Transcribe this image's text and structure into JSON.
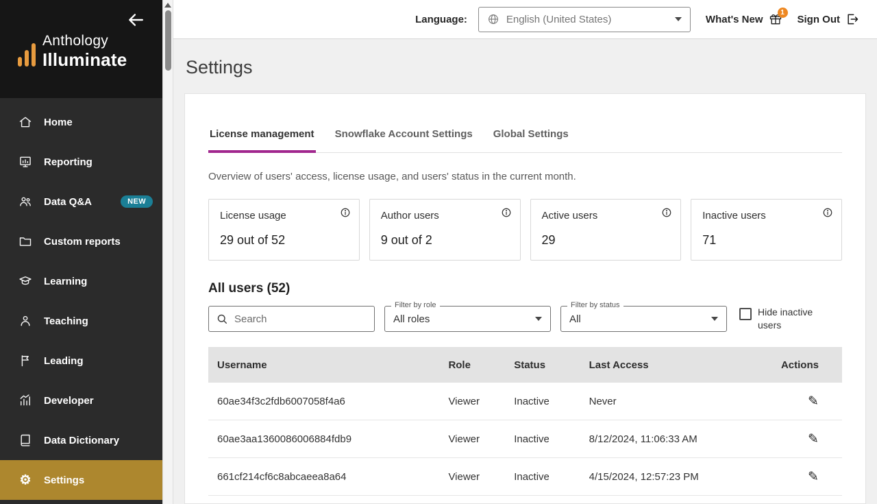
{
  "colors": {
    "gold": "#ad872e",
    "purple": "#a1278e",
    "teal": "#1b7f96",
    "orange": "#ee8822"
  },
  "sidebar": {
    "logo": {
      "line1": "Anthology",
      "line2": "Illuminate"
    },
    "items": [
      {
        "label": "Home"
      },
      {
        "label": "Reporting"
      },
      {
        "label": "Data Q&A",
        "badge": "NEW"
      },
      {
        "label": "Custom reports"
      },
      {
        "label": "Learning"
      },
      {
        "label": "Teaching"
      },
      {
        "label": "Leading"
      },
      {
        "label": "Developer"
      },
      {
        "label": "Data Dictionary"
      },
      {
        "label": "Settings"
      }
    ]
  },
  "topbar": {
    "language_label": "Language:",
    "language_value": "English (United States)",
    "whats_new": "What's New",
    "whats_new_badge": "1",
    "sign_out": "Sign Out"
  },
  "page": {
    "title": "Settings"
  },
  "tabs": [
    {
      "label": "License management"
    },
    {
      "label": "Snowflake Account Settings"
    },
    {
      "label": "Global Settings"
    }
  ],
  "overview_text": "Overview of users' access, license usage, and users' status in the current month.",
  "stats": [
    {
      "label": "License usage",
      "value": "29 out of 52"
    },
    {
      "label": "Author users",
      "value": "9 out of 2"
    },
    {
      "label": "Active users",
      "value": "29"
    },
    {
      "label": "Inactive users",
      "value": "71"
    }
  ],
  "users_section": {
    "heading": "All users (52)",
    "search_placeholder": "Search",
    "role_filter": {
      "label": "Filter by role",
      "value": "All roles"
    },
    "status_filter": {
      "label": "Filter by status",
      "value": "All"
    },
    "hide_inactive_label": "Hide inactive users"
  },
  "table": {
    "headers": [
      "Username",
      "Role",
      "Status",
      "Last Access",
      "Actions"
    ],
    "rows": [
      {
        "username": "60ae34f3c2fdb6007058f4a6",
        "role": "Viewer",
        "status": "Inactive",
        "last_access": "Never"
      },
      {
        "username": "60ae3aa1360086006884fdb9",
        "role": "Viewer",
        "status": "Inactive",
        "last_access": "8/12/2024, 11:06:33 AM"
      },
      {
        "username": "661cf214cf6c8abcaeea8a64",
        "role": "Viewer",
        "status": "Inactive",
        "last_access": "4/15/2024, 12:57:23 PM"
      }
    ]
  }
}
